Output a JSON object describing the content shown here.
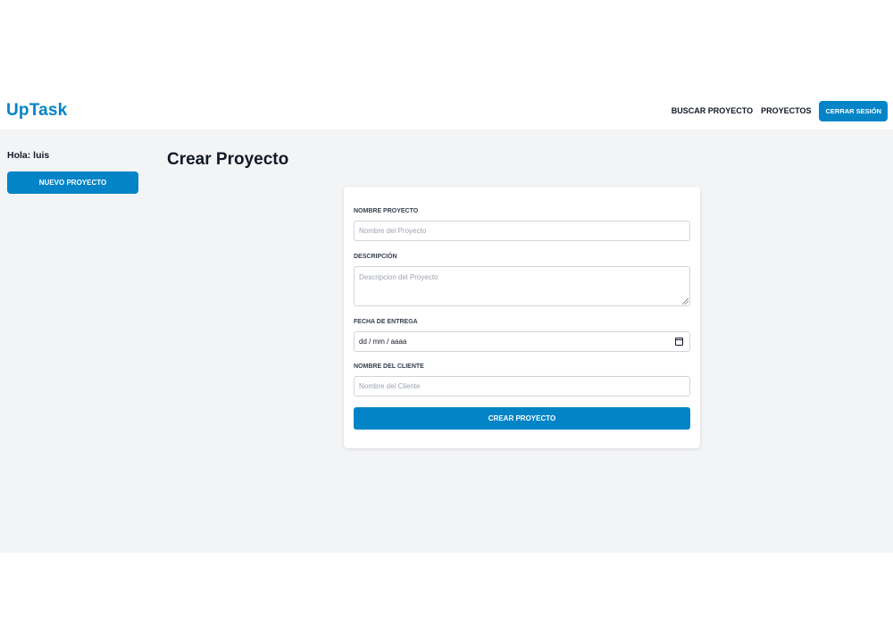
{
  "header": {
    "logo": "UpTask",
    "nav": {
      "search_label": "BUSCAR PROYECTO",
      "projects_label": "PROYECTOS",
      "logout_label": "CERRAR SESIÓN"
    }
  },
  "sidebar": {
    "greeting": "Hola: luis",
    "new_project_label": "NUEVO PROYECTO"
  },
  "main": {
    "title": "Crear Proyecto",
    "form": {
      "name": {
        "label": "NOMBRE PROYECTO",
        "placeholder": "Nombre del Proyecto"
      },
      "description": {
        "label": "DESCRIPCIÓN",
        "placeholder": "Descripcion del Proyecto"
      },
      "date": {
        "label": "FECHA DE ENTREGA",
        "value": "dd / mm / aaaa"
      },
      "client": {
        "label": "NOMBRE DEL CLIENTE",
        "placeholder": "Nombre del Cliente"
      },
      "submit_label": "CREAR PROYECTO"
    }
  },
  "colors": {
    "accent": "#0284c7",
    "background": "#f3f4f6"
  },
  "icons": {
    "date_field": "calendar-icon",
    "textarea": "resize-handle-icon"
  }
}
